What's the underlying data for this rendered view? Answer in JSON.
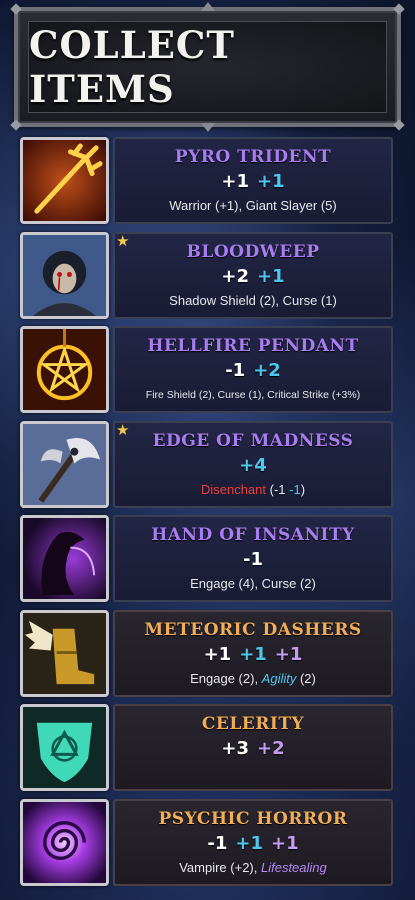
{
  "header": {
    "title": "COLLECT ITEMS"
  },
  "items": [
    {
      "name": "PYRO TRIDENT",
      "tier": "purple",
      "starred": false,
      "icon": "trident-icon",
      "stats": [
        {
          "text": "+1",
          "color": "white"
        },
        {
          "text": "+1",
          "color": "cyan"
        }
      ],
      "traits": [
        {
          "text": "Warrior (+1), Giant Slayer (5)",
          "style": "plain"
        }
      ]
    },
    {
      "name": "BLOODWEEP",
      "tier": "purple",
      "starred": true,
      "icon": "bloodweep-icon",
      "stats": [
        {
          "text": "+2",
          "color": "white"
        },
        {
          "text": "+1",
          "color": "cyan"
        }
      ],
      "traits": [
        {
          "text": "Shadow Shield (2), Curse (1)",
          "style": "plain"
        }
      ]
    },
    {
      "name": "HELLFIRE PENDANT",
      "tier": "purple",
      "starred": false,
      "icon": "pentagram-pendant-icon",
      "stats": [
        {
          "text": "-1",
          "color": "white"
        },
        {
          "text": "+2",
          "color": "cyan"
        }
      ],
      "traits": [
        {
          "text": "Fire Shield (2), Curse (1), Critical Strike (+3%)",
          "style": "plain"
        }
      ],
      "small_traits": true
    },
    {
      "name": "EDGE OF MADNESS",
      "tier": "purple",
      "starred": true,
      "icon": "axe-icon",
      "stats": [
        {
          "text": "+4",
          "color": "cyan"
        }
      ],
      "traits": [
        {
          "text": "Disenchant",
          "style": "red"
        },
        {
          "text": " (-1 ",
          "style": "plain"
        },
        {
          "text": " -1",
          "style": "cyan-n"
        },
        {
          "text": ")",
          "style": "plain"
        }
      ]
    },
    {
      "name": "HAND OF INSANITY",
      "tier": "purple",
      "starred": false,
      "icon": "shadow-hand-icon",
      "stats": [
        {
          "text": "-1",
          "color": "white"
        }
      ],
      "traits": [
        {
          "text": "Engage (4), Curse (2)",
          "style": "plain"
        }
      ]
    },
    {
      "name": "METEORIC DASHERS",
      "tier": "gold",
      "starred": false,
      "icon": "winged-boots-icon",
      "stats": [
        {
          "text": "+1",
          "color": "white"
        },
        {
          "text": "+1",
          "color": "cyan"
        },
        {
          "text": "+1",
          "color": "purple"
        }
      ],
      "traits": [
        {
          "text": "Engage (2), ",
          "style": "plain"
        },
        {
          "text": "Agility",
          "style": "cyan"
        },
        {
          "text": " (2)",
          "style": "plain"
        }
      ]
    },
    {
      "name": "CELERITY",
      "tier": "gold",
      "starred": false,
      "icon": "rune-shield-icon",
      "stats": [
        {
          "text": "+3",
          "color": "white"
        },
        {
          "text": "+2",
          "color": "purple"
        }
      ],
      "traits": []
    },
    {
      "name": "PSYCHIC HORROR",
      "tier": "gold",
      "starred": false,
      "icon": "spiral-vortex-icon",
      "stats": [
        {
          "text": "-1",
          "color": "white"
        },
        {
          "text": "+1",
          "color": "cyan"
        },
        {
          "text": "+1",
          "color": "purple"
        }
      ],
      "traits": [
        {
          "text": "Vampire (+2), ",
          "style": "plain"
        },
        {
          "text": "Lifestealing",
          "style": "purple"
        }
      ]
    }
  ],
  "colors": {
    "purple_name": "#a97df2",
    "gold_name": "#f2ae56",
    "cyan_stat": "#4fc6ee",
    "purple_stat": "#c89cf5",
    "red_trait": "#e84040"
  }
}
